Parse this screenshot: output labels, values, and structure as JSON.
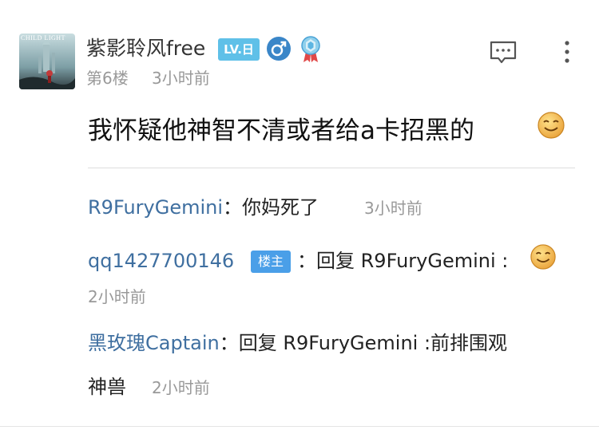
{
  "post": {
    "author": {
      "name": "紫影聆风free",
      "level_badge": "LV.日",
      "avatar_caption": "CHILD LIGHT",
      "gender_icon": "male-symbol-icon",
      "medal_icon": "blue-medal-icon"
    },
    "floor": "第6楼",
    "time": "3小时前",
    "content": "我怀疑他神智不清或者给a卡招黑的",
    "content_emoji": "smile-emoji-icon"
  },
  "replies": [
    {
      "author": "R9FuryGemini",
      "separator": "：",
      "text": "你妈死了",
      "time": "3小时前"
    },
    {
      "author": "qq1427700146",
      "badge": "楼主",
      "separator": "：",
      "text": "回复 R9FuryGemini :",
      "emoji": "smile-emoji-icon",
      "time": "2小时前"
    },
    {
      "author": "黑玫瑰Captain",
      "separator": "：",
      "text_line1": "回复 R9FuryGemini :前排围观",
      "text_line2": "神兽",
      "time": "2小时前"
    }
  ],
  "colors": {
    "link": "#3f6fa0",
    "level_badge": "#5fc0e8",
    "op_badge": "#4a9fe8",
    "meta_text": "#999999"
  }
}
